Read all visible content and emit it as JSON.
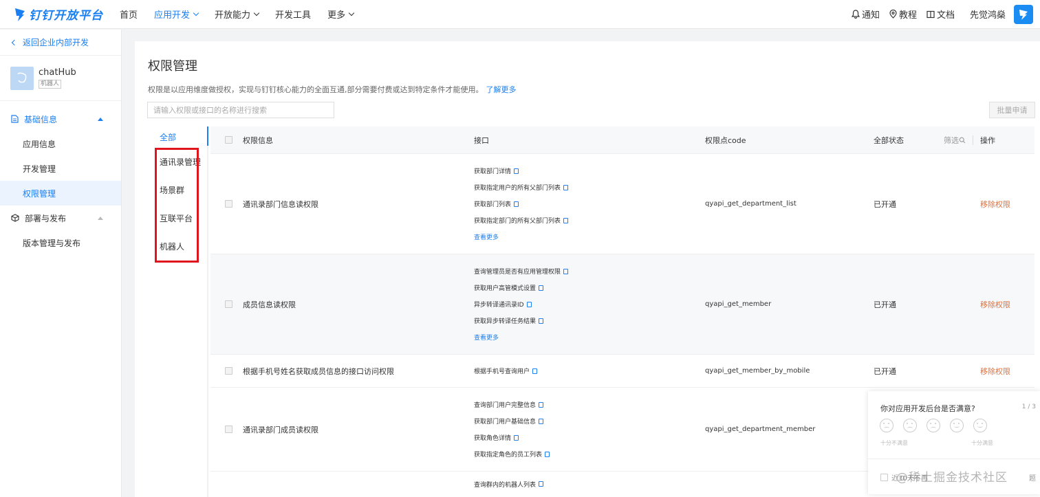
{
  "brand": {
    "name": "钉钉开放平台"
  },
  "nav": {
    "items": [
      {
        "label": "首页",
        "active": false,
        "dropdown": false
      },
      {
        "label": "应用开发",
        "active": true,
        "dropdown": true
      },
      {
        "label": "开放能力",
        "active": false,
        "dropdown": true
      },
      {
        "label": "开发工具",
        "active": false,
        "dropdown": false
      },
      {
        "label": "更多",
        "active": false,
        "dropdown": true
      }
    ],
    "notify": "通知",
    "tutorial": "教程",
    "docs": "文档",
    "org": "先觉鸿燊"
  },
  "sidebar": {
    "back": "返回企业内部开发",
    "app_name": "chatHub",
    "app_tag": "机器人",
    "group1": "基础信息",
    "group1_items": [
      "应用信息",
      "开发管理",
      "权限管理"
    ],
    "group2": "部署与发布",
    "group2_items": [
      "版本管理与发布"
    ]
  },
  "page": {
    "title": "权限管理",
    "desc": "权限是以应用维度做授权，实现与钉钉核心能力的全面互通,部分需要付费或达到特定条件才能使用。",
    "learn_more": "了解更多",
    "search_placeholder": "请输入权限或接口的名称进行搜索",
    "batch_apply": "批量申请"
  },
  "categories": [
    "全部",
    "通讯录管理",
    "场景群",
    "互联平台",
    "机器人"
  ],
  "table": {
    "headers": {
      "info": "权限信息",
      "api": "接口",
      "code": "权限点code",
      "status": "全部状态",
      "filter": "筛选",
      "op": "操作"
    },
    "rows": [
      {
        "name": "通讯录部门信息读权限",
        "apis": [
          "获取部门详情",
          "获取指定用户的所有父部门列表",
          "获取部门列表",
          "获取指定部门的所有父部门列表"
        ],
        "more": "查看更多",
        "code": "qyapi_get_department_list",
        "status": "已开通",
        "action": "移除权限"
      },
      {
        "name": "成员信息读权限",
        "apis": [
          "查询管理员是否有应用管理权限",
          "获取用户高管模式设置",
          "异步转译通讯录ID",
          "获取异步转译任务结果"
        ],
        "more": "查看更多",
        "code": "qyapi_get_member",
        "status": "已开通",
        "action": "移除权限"
      },
      {
        "name": "根据手机号姓名获取成员信息的接口访问权限",
        "apis": [
          "根据手机号查询用户"
        ],
        "more": "",
        "code": "qyapi_get_member_by_mobile",
        "status": "已开通",
        "action": "移除权限"
      },
      {
        "name": "通讯录部门成员读权限",
        "apis": [
          "查询部门用户完整信息",
          "获取部门用户基础信息",
          "获取角色详情",
          "获取指定角色的员工列表"
        ],
        "more": "",
        "code": "qyapi_get_department_member",
        "status": "",
        "action": ""
      },
      {
        "name": "",
        "apis": [
          "查询群内的机器人列表"
        ],
        "more": "",
        "code": "",
        "status": "",
        "action": ""
      }
    ]
  },
  "survey": {
    "question": "你对应用开发后台是否满意?",
    "page": "1 / 3",
    "low": "十分不满意",
    "high": "十分满意",
    "dont_show": "近30天不再",
    "tail": "题"
  },
  "watermark": "@稀土掘金技术社区",
  "colors": {
    "accent": "#1a7ff0",
    "danger": "#e2703b",
    "highlight": "#e0141c"
  }
}
